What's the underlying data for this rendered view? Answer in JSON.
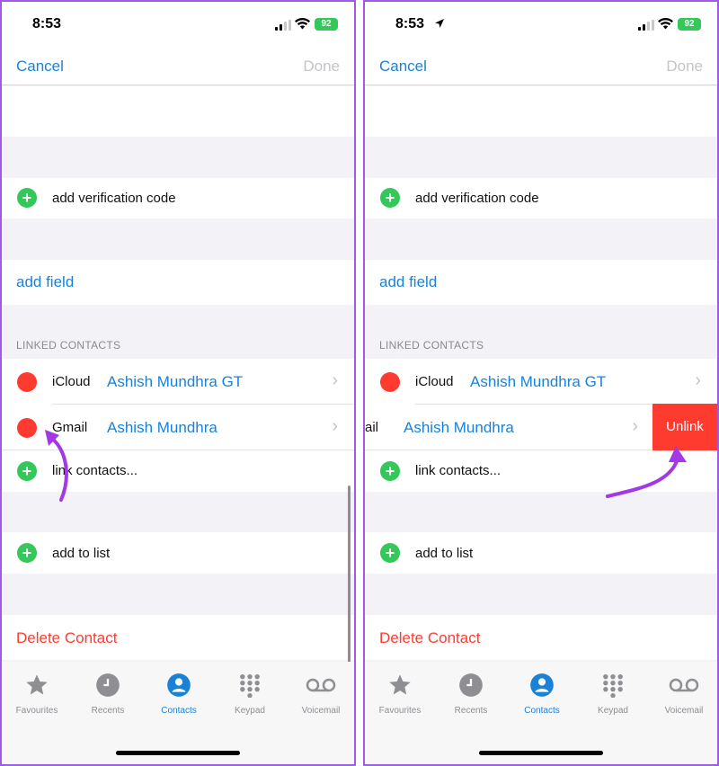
{
  "panels": [
    {
      "status": {
        "time": "8:53",
        "battery": "92"
      },
      "nav": {
        "cancel": "Cancel",
        "done": "Done"
      },
      "add_verification": "add verification code",
      "add_field": "add field",
      "section_header": "LINKED CONTACTS",
      "linked": [
        {
          "source": "iCloud",
          "name": "Ashish Mundhra GT"
        },
        {
          "source": "Gmail",
          "name": "Ashish Mundhra"
        }
      ],
      "link_contacts": "link contacts...",
      "add_to_list": "add to list",
      "delete_contact": "Delete Contact"
    },
    {
      "status": {
        "time": "8:53",
        "battery": "92"
      },
      "nav": {
        "cancel": "Cancel",
        "done": "Done"
      },
      "add_verification": "add verification code",
      "add_field": "add field",
      "section_header": "LINKED CONTACTS",
      "linked": [
        {
          "source": "iCloud",
          "name": "Ashish Mundhra GT"
        },
        {
          "source": "ail",
          "name": "Ashish Mundhra"
        }
      ],
      "unlink": "Unlink",
      "link_contacts": "link contacts...",
      "add_to_list": "add to list",
      "delete_contact": "Delete Contact"
    }
  ],
  "tabs": [
    "Favourites",
    "Recents",
    "Contacts",
    "Keypad",
    "Voicemail"
  ],
  "colors": {
    "accent": "#1a82d6",
    "green": "#34c759",
    "red": "#ff3b30",
    "arrow": "#a238e6"
  }
}
